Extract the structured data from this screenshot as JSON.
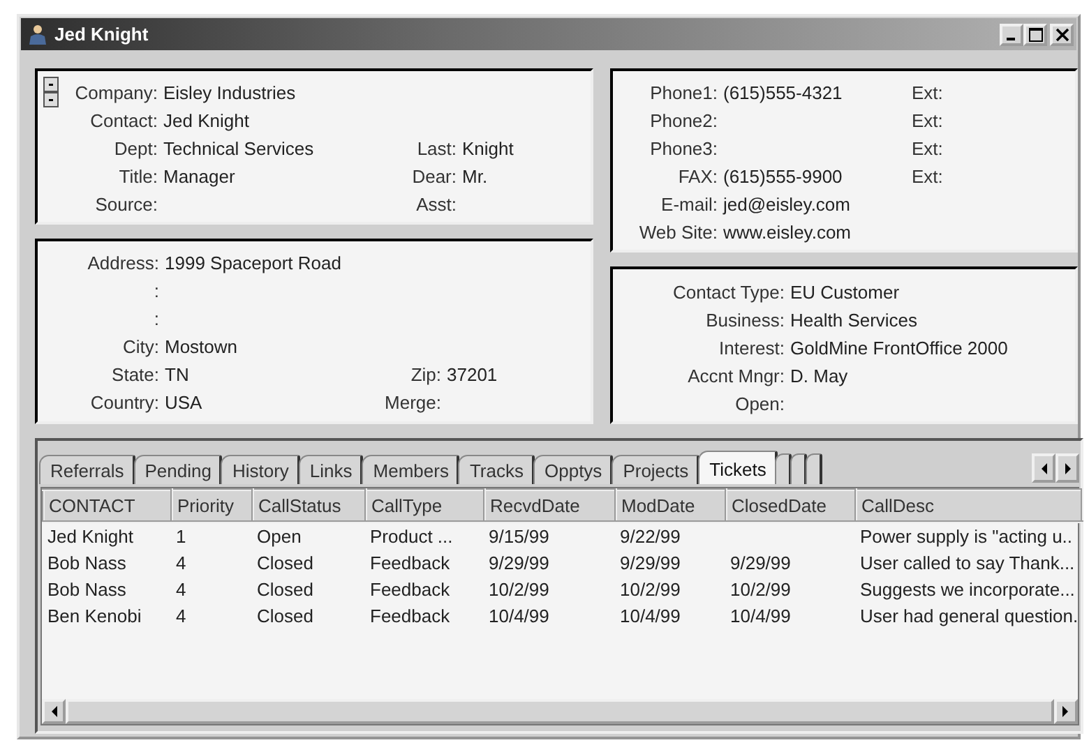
{
  "window": {
    "title": "Jed Knight"
  },
  "panels": [
    {
      "rows": [
        {
          "label": "Company:",
          "value": "Eisley Industries"
        },
        {
          "label": "Contact:",
          "value": "Jed Knight"
        },
        {
          "label": "Dept:",
          "value": "Technical Services",
          "label2": "Last:",
          "value2": "Knight"
        },
        {
          "label": "Title:",
          "value": "Manager",
          "label2": "Dear:",
          "value2": "Mr."
        },
        {
          "label": "Source:",
          "label2": "Asst:"
        }
      ]
    },
    {
      "rows": [
        {
          "label": "Phone1:",
          "value": "(615)555-4321",
          "label2": "Ext:"
        },
        {
          "label": "Phone2:",
          "label2": "Ext:"
        },
        {
          "label": "Phone3:",
          "label2": "Ext:"
        },
        {
          "label": "FAX:",
          "value": "(615)555-9900",
          "label2": "Ext:"
        },
        {
          "label": "E-mail:",
          "value": "jed@eisley.com"
        },
        {
          "label": "Web Site:",
          "value": "www.eisley.com"
        }
      ]
    },
    {
      "rows": [
        {
          "label": "Address:",
          "value": "1999 Spaceport Road"
        },
        {
          "label": ":"
        },
        {
          "label": ":"
        },
        {
          "label": "City:",
          "value": "Mostown"
        },
        {
          "label": "State:",
          "value": "TN",
          "label2": "Zip:",
          "value2": "37201"
        },
        {
          "label": "Country:",
          "value": "USA",
          "label2": "Merge:"
        }
      ]
    },
    {
      "rows": [
        {
          "label": "Contact Type:",
          "value": "EU Customer"
        },
        {
          "label": "Business:",
          "value": "Health Services"
        },
        {
          "label": "Interest:",
          "value": "GoldMine FrontOffice 2000"
        },
        {
          "label": "Accnt Mngr:",
          "value": "D. May"
        },
        {
          "label": "Open:"
        }
      ]
    }
  ],
  "tabs": [
    {
      "label": "Referrals",
      "selected": false
    },
    {
      "label": "Pending",
      "selected": false
    },
    {
      "label": "History",
      "selected": false
    },
    {
      "label": "Links",
      "selected": false
    },
    {
      "label": "Members",
      "selected": false
    },
    {
      "label": "Tracks",
      "selected": false
    },
    {
      "label": "Opptys",
      "selected": false
    },
    {
      "label": "Projects",
      "selected": false
    },
    {
      "label": "Tickets",
      "selected": true
    }
  ],
  "table": {
    "columns": [
      "CONTACT",
      "Priority",
      "CallStatus",
      "CallType",
      "RecvdDate",
      "ModDate",
      "ClosedDate",
      "CallDesc"
    ],
    "rows": [
      [
        "Jed Knight",
        "1",
        "Open",
        "Product ...",
        "9/15/99",
        "9/22/99",
        null,
        "Power supply is \"acting u.."
      ],
      [
        "Bob Nass",
        "4",
        "Closed",
        "Feedback",
        "9/29/99",
        "9/29/99",
        "9/29/99",
        "User called to say Thank..."
      ],
      [
        "Bob Nass",
        "4",
        "Closed",
        "Feedback",
        "10/2/99",
        "10/2/99",
        "10/2/99",
        "Suggests we incorporate..."
      ],
      [
        "Ben Kenobi",
        "4",
        "Closed",
        "Feedback",
        "10/4/99",
        "10/4/99",
        "10/4/99",
        "User had general question."
      ]
    ]
  }
}
